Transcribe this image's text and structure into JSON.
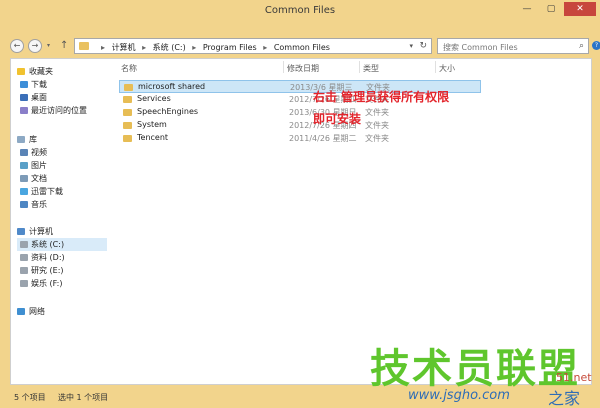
{
  "window": {
    "title": "Common Files",
    "minimize": "—",
    "maximize": "▢",
    "close": "✕"
  },
  "nav": {
    "back": "←",
    "forward": "→",
    "dropdown": "▾",
    "up": "↑"
  },
  "address": {
    "crumbs": [
      "计算机",
      "系统 (C:)",
      "Program Files",
      "Common Files"
    ],
    "separator": "▸",
    "dropdown": "▾",
    "refresh": "↻"
  },
  "search": {
    "placeholder": "搜索 Common Files",
    "icon": "⌕"
  },
  "help": "?",
  "sidebar": {
    "favorites": {
      "label": "收藏夹",
      "items": [
        "下载",
        "桌面",
        "最近访问的位置"
      ]
    },
    "libraries": {
      "label": "库",
      "items": [
        "视频",
        "图片",
        "文档",
        "迅雷下载",
        "音乐"
      ]
    },
    "computer": {
      "label": "计算机",
      "items": [
        "系统 (C:)",
        "资料 (D:)",
        "研究 (E:)",
        "娱乐 (F:)"
      ],
      "selected_index": 0
    },
    "network": {
      "label": "网络"
    }
  },
  "columns": {
    "name": "名称",
    "date": "修改日期",
    "type": "类型",
    "size": "大小"
  },
  "files": [
    {
      "name": "microsoft shared",
      "date": "2013/3/6 星期三",
      "type": "文件夹",
      "selected": true
    },
    {
      "name": "Services",
      "date": "2012/7/26 星期四",
      "type": "文件夹"
    },
    {
      "name": "SpeechEngines",
      "date": "2013/6/30 星期日",
      "type": "文件夹"
    },
    {
      "name": "System",
      "date": "2012/7/26 星期四",
      "type": "文件夹"
    },
    {
      "name": "Tencent",
      "date": "2011/4/26 星期二",
      "type": "文件夹"
    }
  ],
  "annotation": {
    "line1": "右击 管理员获得所有权限",
    "line2": "即可安装"
  },
  "status": {
    "count": "5 个项目",
    "selected": "选中 1 个项目"
  },
  "watermark": {
    "brand": "技术员联盟",
    "url": "www.jsgho.com",
    "net": "51.net",
    "zhi": "之家"
  }
}
